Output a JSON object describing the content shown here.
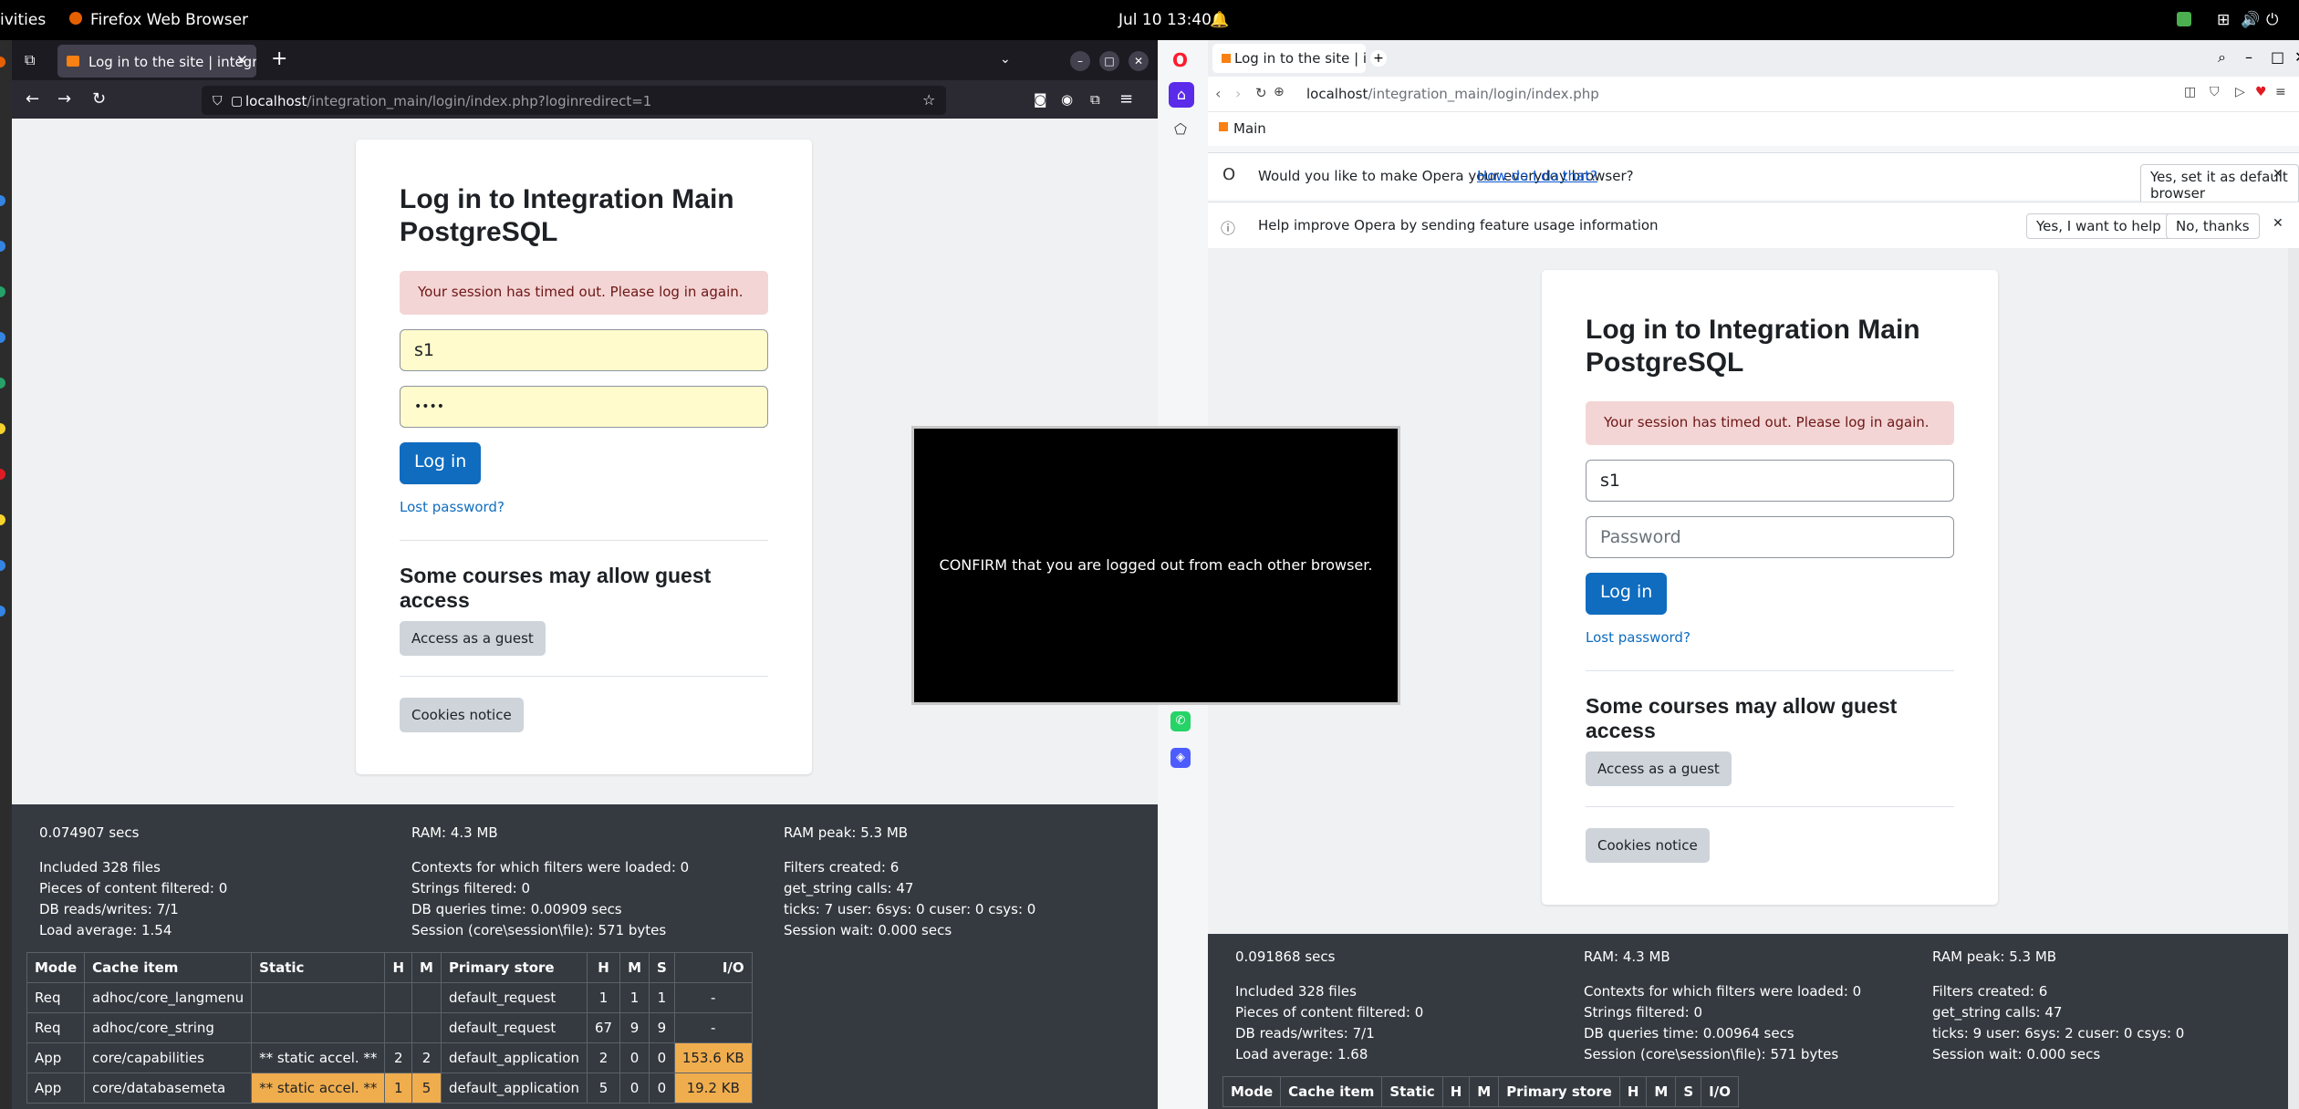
{
  "topbar": {
    "activities": "ivities",
    "app_name": "Firefox Web Browser",
    "datetime": "Jul 10  13:40"
  },
  "firefox": {
    "tab_title": "Log in to the site | integra",
    "url_host": "localhost",
    "url_path": "/integration_main/login/index.php?loginredirect=1"
  },
  "opera": {
    "tab_title": "Log in to the site | in",
    "url_host": "localhost",
    "url_path": "/integration_main/login/index.php",
    "bookmark": "Main",
    "default_prompt": "Would you like to make Opera your everyday browser?",
    "default_link": "How do I do that?",
    "default_button": "Yes, set it as default browser",
    "improve_prompt": "Help improve Opera by sending feature usage information",
    "improve_yes": "Yes, I want to help",
    "improve_no": "No, thanks"
  },
  "login": {
    "title_line1": "Log in to Integration Main",
    "title_line2": "PostgreSQL",
    "alert": "Your session has timed out. Please log in again.",
    "username": "s1",
    "password_dots": "••••",
    "password_placeholder": "Password",
    "login_button": "Log in",
    "lost_password": "Lost password?",
    "guest_heading_line1": "Some courses may allow guest",
    "guest_heading_line2": "access",
    "guest_button": "Access as a guest",
    "cookies_button": "Cookies notice"
  },
  "overlay_text": "CONFIRM that you are logged out from each other browser.",
  "perf_left": {
    "time": "0.074907 secs",
    "ram": "RAM: 4.3 MB",
    "ram_peak": "RAM peak: 5.3 MB",
    "files": "Included 328 files",
    "filtered": "Pieces of content filtered: 0",
    "db_rw": "DB reads/writes: 7/1",
    "load": "Load average: 1.54",
    "contexts": "Contexts for which filters were loaded: 0",
    "strings": "Strings filtered: 0",
    "db_time": "DB queries time: 0.00909 secs",
    "session": "Session (core\\session\\file): 571 bytes",
    "filters": "Filters created: 6",
    "get_string": "get_string calls: 47",
    "ticks": "ticks: 7 user: 6sys: 0 cuser: 0 csys: 0",
    "session_wait": "Session wait: 0.000 secs"
  },
  "perf_right": {
    "time": "0.091868 secs",
    "ram": "RAM: 4.3 MB",
    "ram_peak": "RAM peak: 5.3 MB",
    "files": "Included 328 files",
    "filtered": "Pieces of content filtered: 0",
    "db_rw": "DB reads/writes: 7/1",
    "load": "Load average: 1.68",
    "contexts": "Contexts for which filters were loaded: 0",
    "strings": "Strings filtered: 0",
    "db_time": "DB queries time: 0.00964 secs",
    "session": "Session (core\\session\\file): 571 bytes",
    "filters": "Filters created: 6",
    "get_string": "get_string calls: 47",
    "ticks": "ticks: 9 user: 6sys: 2 cuser: 0 csys: 0",
    "session_wait": "Session wait: 0.000 secs"
  },
  "cache_headers": [
    "Mode",
    "Cache item",
    "Static",
    "H",
    "M",
    "Primary store",
    "H",
    "M",
    "S",
    "I/O"
  ],
  "cache_rows": [
    [
      "Req",
      "adhoc/core_langmenu",
      "",
      "",
      "",
      "default_request",
      "1",
      "1",
      "1",
      "-"
    ],
    [
      "Req",
      "adhoc/core_string",
      "",
      "",
      "",
      "default_request",
      "67",
      "9",
      "9",
      "-"
    ],
    [
      "App",
      "core/capabilities",
      "** static accel. **",
      "2",
      "2",
      "default_application",
      "2",
      "0",
      "0",
      "153.6 KB"
    ],
    [
      "App",
      "core/databasemeta",
      "** static accel. **",
      "1",
      "5",
      "default_application",
      "5",
      "0",
      "0",
      "19.2 KB"
    ]
  ],
  "colors": {
    "primary": "#0f6cbf",
    "alert_bg": "#f3d5d5",
    "footer_bg": "#343a40",
    "autofill": "#fffbcc",
    "highlight": "#f0ad4e"
  }
}
